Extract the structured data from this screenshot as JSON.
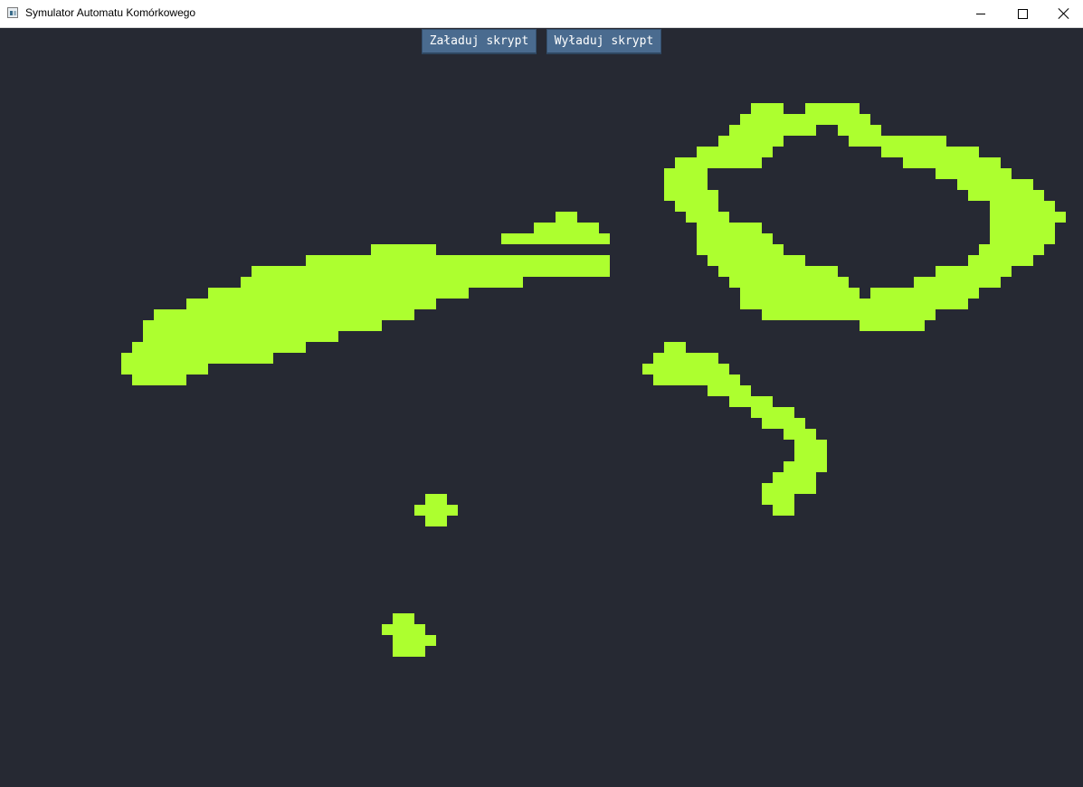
{
  "window": {
    "title": "Symulator Automatu Komórkowego"
  },
  "toolbar": {
    "load_label": "Załaduj skrypt",
    "unload_label": "Wyładuj skrypt"
  },
  "colors": {
    "background": "#262933",
    "live_cell": "#adff2f",
    "button": "#4a6b8f"
  },
  "grid": {
    "cell_size": 12,
    "rows": [
      {
        "r": 7,
        "spans": [
          [
            69,
            71
          ],
          [
            74,
            78
          ]
        ]
      },
      {
        "r": 8,
        "spans": [
          [
            68,
            79
          ]
        ]
      },
      {
        "r": 9,
        "spans": [
          [
            67,
            74
          ],
          [
            77,
            80
          ]
        ]
      },
      {
        "r": 10,
        "spans": [
          [
            66,
            71
          ],
          [
            78,
            86
          ]
        ]
      },
      {
        "r": 11,
        "spans": [
          [
            64,
            70
          ],
          [
            81,
            89
          ]
        ]
      },
      {
        "r": 12,
        "spans": [
          [
            62,
            69
          ],
          [
            83,
            91
          ]
        ]
      },
      {
        "r": 13,
        "spans": [
          [
            61,
            64
          ],
          [
            86,
            92
          ]
        ]
      },
      {
        "r": 14,
        "spans": [
          [
            61,
            64
          ],
          [
            88,
            94
          ]
        ]
      },
      {
        "r": 15,
        "spans": [
          [
            61,
            65
          ],
          [
            89,
            95
          ]
        ]
      },
      {
        "r": 16,
        "spans": [
          [
            62,
            65
          ],
          [
            91,
            96
          ]
        ]
      },
      {
        "r": 17,
        "spans": [
          [
            51,
            52
          ],
          [
            63,
            66
          ],
          [
            91,
            97
          ]
        ]
      },
      {
        "r": 18,
        "spans": [
          [
            49,
            54
          ],
          [
            64,
            69
          ],
          [
            91,
            96
          ]
        ]
      },
      {
        "r": 19,
        "spans": [
          [
            46,
            55
          ],
          [
            64,
            70
          ],
          [
            91,
            96
          ]
        ]
      },
      {
        "r": 20,
        "spans": [
          [
            34,
            39
          ],
          [
            64,
            71
          ],
          [
            90,
            95
          ]
        ]
      },
      {
        "r": 21,
        "spans": [
          [
            28,
            55
          ],
          [
            65,
            73
          ],
          [
            89,
            94
          ]
        ]
      },
      {
        "r": 22,
        "spans": [
          [
            23,
            55
          ],
          [
            66,
            76
          ],
          [
            86,
            92
          ]
        ]
      },
      {
        "r": 23,
        "spans": [
          [
            22,
            47
          ],
          [
            67,
            77
          ],
          [
            84,
            91
          ]
        ]
      },
      {
        "r": 24,
        "spans": [
          [
            19,
            42
          ],
          [
            68,
            78
          ],
          [
            80,
            89
          ]
        ]
      },
      {
        "r": 25,
        "spans": [
          [
            17,
            39
          ],
          [
            68,
            88
          ]
        ]
      },
      {
        "r": 26,
        "spans": [
          [
            14,
            37
          ],
          [
            70,
            85
          ]
        ]
      },
      {
        "r": 27,
        "spans": [
          [
            13,
            34
          ],
          [
            79,
            84
          ]
        ]
      },
      {
        "r": 28,
        "spans": [
          [
            13,
            30
          ]
        ]
      },
      {
        "r": 29,
        "spans": [
          [
            12,
            27
          ],
          [
            61,
            62
          ]
        ]
      },
      {
        "r": 30,
        "spans": [
          [
            11,
            24
          ],
          [
            60,
            65
          ]
        ]
      },
      {
        "r": 31,
        "spans": [
          [
            11,
            18
          ],
          [
            59,
            66
          ]
        ]
      },
      {
        "r": 32,
        "spans": [
          [
            12,
            16
          ],
          [
            60,
            67
          ]
        ]
      },
      {
        "r": 33,
        "spans": [
          [
            65,
            68
          ]
        ]
      },
      {
        "r": 34,
        "spans": [
          [
            67,
            70
          ]
        ]
      },
      {
        "r": 35,
        "spans": [
          [
            69,
            72
          ]
        ]
      },
      {
        "r": 36,
        "spans": [
          [
            70,
            73
          ]
        ]
      },
      {
        "r": 37,
        "spans": [
          [
            72,
            74
          ]
        ]
      },
      {
        "r": 38,
        "spans": [
          [
            73,
            75
          ]
        ]
      },
      {
        "r": 39,
        "spans": [
          [
            73,
            75
          ]
        ]
      },
      {
        "r": 40,
        "spans": [
          [
            72,
            75
          ]
        ]
      },
      {
        "r": 41,
        "spans": [
          [
            71,
            74
          ]
        ]
      },
      {
        "r": 42,
        "spans": [
          [
            70,
            74
          ]
        ]
      },
      {
        "r": 43,
        "spans": [
          [
            39,
            40
          ],
          [
            70,
            72
          ]
        ]
      },
      {
        "r": 44,
        "spans": [
          [
            38,
            41
          ],
          [
            71,
            72
          ]
        ]
      },
      {
        "r": 45,
        "spans": [
          [
            39,
            40
          ]
        ]
      },
      {
        "r": 54,
        "spans": [
          [
            36,
            37
          ]
        ]
      },
      {
        "r": 55,
        "spans": [
          [
            35,
            38
          ]
        ]
      },
      {
        "r": 56,
        "spans": [
          [
            36,
            39
          ]
        ]
      },
      {
        "r": 57,
        "spans": [
          [
            36,
            38
          ]
        ]
      }
    ]
  }
}
